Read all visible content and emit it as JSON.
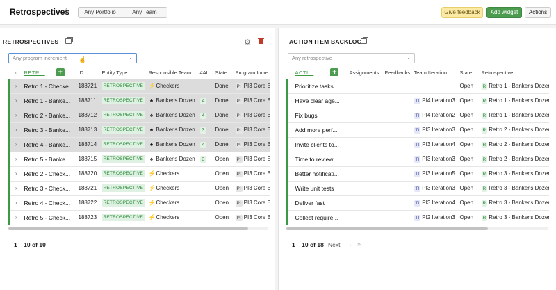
{
  "header": {
    "title": "Retrospectives",
    "portfolio_filter": "Any Portfolio",
    "team_filter": "Any Team",
    "feedback_label": "Give feedback",
    "add_widget_label": "Add widget",
    "actions_label": "Actions"
  },
  "retro_panel": {
    "title": "RETROSPECTIVES",
    "filter_placeholder": "Any program increment",
    "columns": [
      "RETR...",
      "ID",
      "Entity Type",
      "Responsible Team",
      "#AI",
      "State",
      "Program Incre"
    ],
    "rows": [
      {
        "name": "Retro 1 - Checke...",
        "id": "188721",
        "type": "RETROSPECTIVE",
        "team": "Checkers",
        "team_icon": "bolt",
        "ai": "",
        "state": "Done",
        "pi_tag": "PI",
        "pi": "PI3 Core B",
        "selected": true
      },
      {
        "name": "Retro 1 - Banke...",
        "id": "188711",
        "type": "RETROSPECTIVE",
        "team": "Banker's Dozen",
        "team_icon": "spade",
        "ai": "4",
        "state": "Done",
        "pi_tag": "PI",
        "pi": "PI3 Core B",
        "selected": true
      },
      {
        "name": "Retro 2 - Banke...",
        "id": "188712",
        "type": "RETROSPECTIVE",
        "team": "Banker's Dozen",
        "team_icon": "spade",
        "ai": "4",
        "state": "Done",
        "pi_tag": "PI",
        "pi": "PI3 Core B",
        "selected": true
      },
      {
        "name": "Retro 3 - Banke...",
        "id": "188713",
        "type": "RETROSPECTIVE",
        "team": "Banker's Dozen",
        "team_icon": "spade",
        "ai": "3",
        "state": "Done",
        "pi_tag": "PI",
        "pi": "PI3 Core B",
        "selected": true
      },
      {
        "name": "Retro 4 - Banke...",
        "id": "188714",
        "type": "RETROSPECTIVE",
        "team": "Banker's Dozen",
        "team_icon": "spade",
        "ai": "4",
        "state": "Done",
        "pi_tag": "PI",
        "pi": "PI3 Core B",
        "selected": true
      },
      {
        "name": "Retro 5 - Banke...",
        "id": "188715",
        "type": "RETROSPECTIVE",
        "team": "Banker's Dozen",
        "team_icon": "spade",
        "ai": "3",
        "state": "Open",
        "pi_tag": "PI",
        "pi": "PI3 Core B",
        "selected": false
      },
      {
        "name": "Retro 2 - Check...",
        "id": "188720",
        "type": "RETROSPECTIVE",
        "team": "Checkers",
        "team_icon": "bolt",
        "ai": "",
        "state": "Open",
        "pi_tag": "PI",
        "pi": "PI3 Core B",
        "selected": false
      },
      {
        "name": "Retro 3 - Check...",
        "id": "188721",
        "type": "RETROSPECTIVE",
        "team": "Checkers",
        "team_icon": "bolt",
        "ai": "",
        "state": "Open",
        "pi_tag": "PI",
        "pi": "PI3 Core B",
        "selected": false
      },
      {
        "name": "Retro 4 - Check...",
        "id": "188722",
        "type": "RETROSPECTIVE",
        "team": "Checkers",
        "team_icon": "bolt",
        "ai": "",
        "state": "Open",
        "pi_tag": "PI",
        "pi": "PI3 Core B",
        "selected": false
      },
      {
        "name": "Retro 5 - Check...",
        "id": "188723",
        "type": "RETROSPECTIVE",
        "team": "Checkers",
        "team_icon": "bolt",
        "ai": "",
        "state": "Open",
        "pi_tag": "PI",
        "pi": "PI3 Core B",
        "selected": false
      }
    ],
    "pagination": "1 – 10 of 10"
  },
  "action_panel": {
    "title": "ACTION ITEM BACKLOG",
    "filter_placeholder": "Any retrospective",
    "columns": [
      "ACTI...",
      "Assignments",
      "Feedbacks",
      "Team Iteration",
      "State",
      "Retrospective"
    ],
    "rows": [
      {
        "name": "Prioritize tasks",
        "iter_tag": "",
        "iteration": "",
        "state": "Open",
        "retro_tag": "R",
        "retro": "Retro 1 - Banker's Dozen"
      },
      {
        "name": "Have clear age...",
        "iter_tag": "TI",
        "iteration": "PI4 Iteration3",
        "state": "Open",
        "retro_tag": "R",
        "retro": "Retro 1 - Banker's Dozen"
      },
      {
        "name": "Fix bugs",
        "iter_tag": "TI",
        "iteration": "PI4 Iteration2",
        "state": "Open",
        "retro_tag": "R",
        "retro": "Retro 1 - Banker's Dozen"
      },
      {
        "name": "Add more perf...",
        "iter_tag": "TI",
        "iteration": "PI3 Iteration3",
        "state": "Open",
        "retro_tag": "R",
        "retro": "Retro 2 - Banker's Dozen"
      },
      {
        "name": "Invite clients to...",
        "iter_tag": "TI",
        "iteration": "PI3 Iteration4",
        "state": "Open",
        "retro_tag": "R",
        "retro": "Retro 2 - Banker's Dozen"
      },
      {
        "name": "Time to review ...",
        "iter_tag": "TI",
        "iteration": "PI3 Iteration3",
        "state": "Open",
        "retro_tag": "R",
        "retro": "Retro 2 - Banker's Dozen"
      },
      {
        "name": "Better notificati...",
        "iter_tag": "TI",
        "iteration": "PI3 Iteration5",
        "state": "Open",
        "retro_tag": "R",
        "retro": "Retro 3 - Banker's Dozen"
      },
      {
        "name": "Write unit tests",
        "iter_tag": "TI",
        "iteration": "PI3 Iteration3",
        "state": "Open",
        "retro_tag": "R",
        "retro": "Retro 3 - Banker's Dozen"
      },
      {
        "name": "Deliver fast",
        "iter_tag": "TI",
        "iteration": "PI3 Iteration4",
        "state": "Open",
        "retro_tag": "R",
        "retro": "Retro 3 - Banker's Dozen"
      },
      {
        "name": "Collect require...",
        "iter_tag": "TI",
        "iteration": "PI2 Iteration3",
        "state": "Open",
        "retro_tag": "R",
        "retro": "Retro 3 - Banker's Dozen"
      }
    ],
    "pagination": "1 – 10 of 18",
    "next_label": "Next"
  },
  "colors": {
    "accent_green": "#3c9a45",
    "feedback_yellow": "#fbe9a6",
    "selected_row": "#dcdcdc"
  }
}
